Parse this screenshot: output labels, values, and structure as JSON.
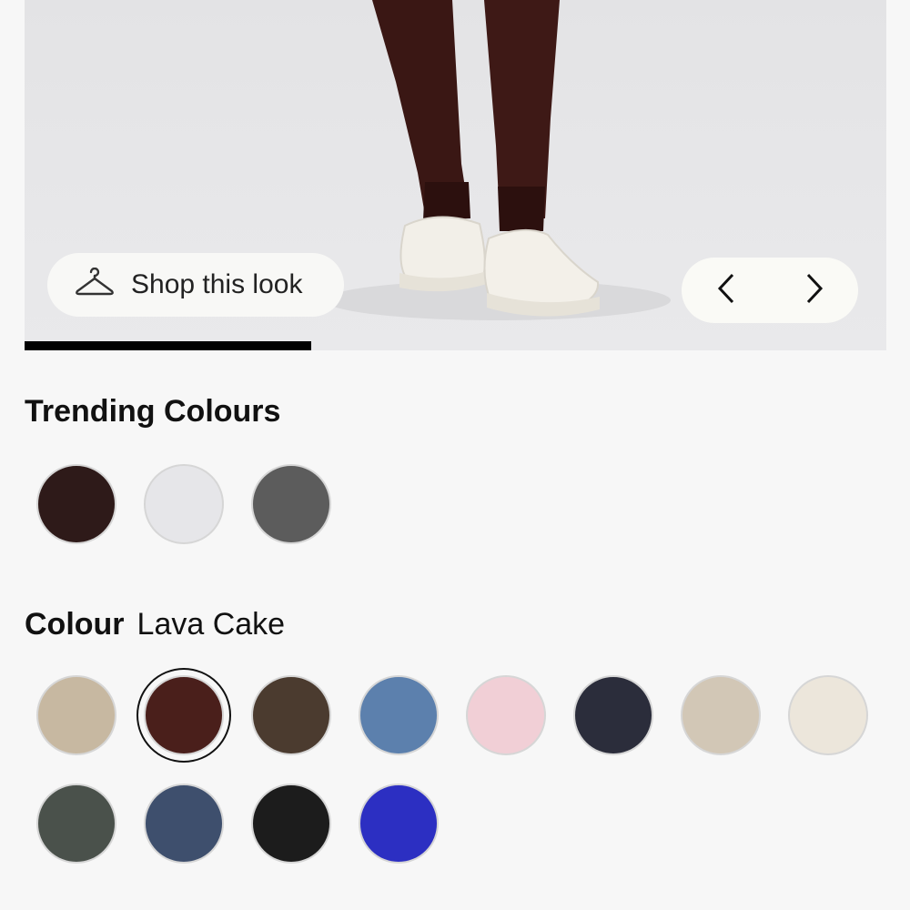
{
  "hero": {
    "shop_label": "Shop this look",
    "icons": {
      "shop": "hanger-icon",
      "prev": "chevron-left-icon",
      "next": "chevron-right-icon"
    },
    "gallery_progress": 0.333
  },
  "trending": {
    "title": "Trending Colours",
    "swatches": [
      {
        "color": "#2e1a19"
      },
      {
        "color": "#e6e6e9"
      },
      {
        "color": "#5c5c5c"
      }
    ]
  },
  "colour": {
    "label": "Colour",
    "selected_name": "Lava Cake",
    "selected_index": 1,
    "swatches": [
      {
        "color": "#c7b8a1"
      },
      {
        "color": "#4a1f1b"
      },
      {
        "color": "#4b3b2f"
      },
      {
        "color": "#5c80ad"
      },
      {
        "color": "#f1cfd6"
      },
      {
        "color": "#2b2d3b"
      },
      {
        "color": "#d2c7b6"
      },
      {
        "color": "#ece6db"
      },
      {
        "color": "#4a514b"
      },
      {
        "color": "#3e4f6d"
      },
      {
        "color": "#1c1c1c"
      },
      {
        "color": "#2c2fc2"
      }
    ]
  }
}
